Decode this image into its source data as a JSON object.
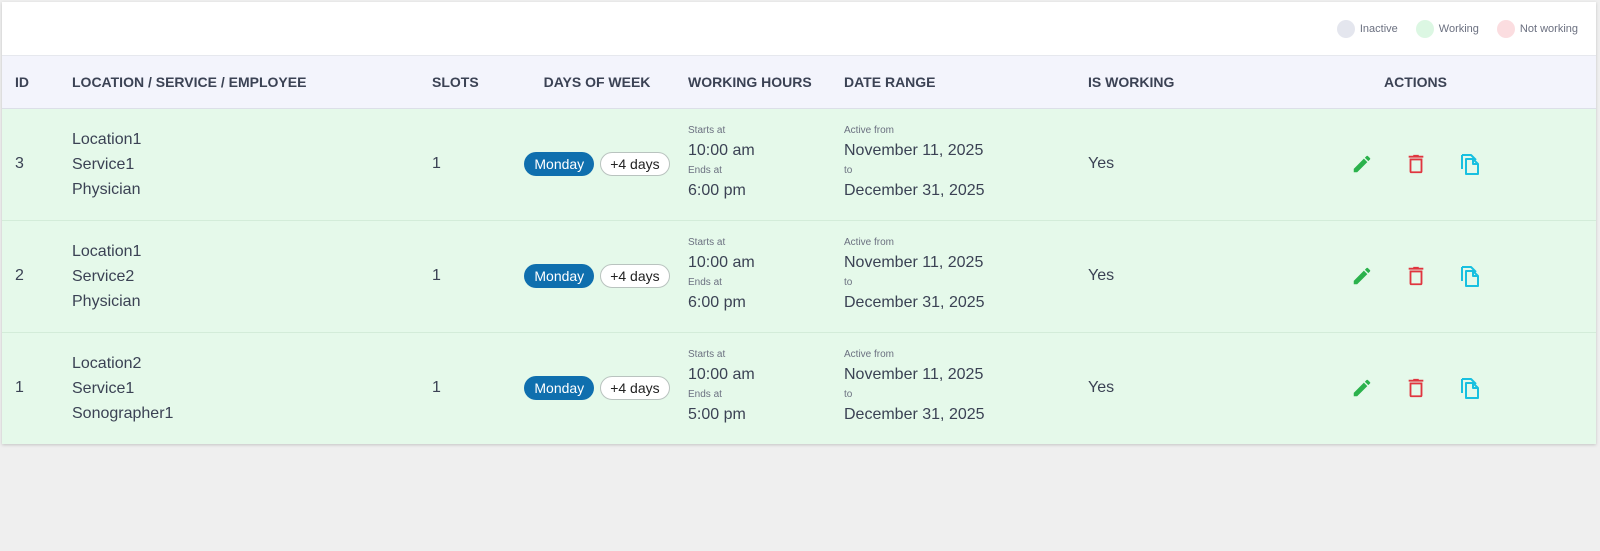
{
  "legend": [
    {
      "label": "Inactive",
      "color": "#e4e6ee"
    },
    {
      "label": "Working",
      "color": "#dcf7e3"
    },
    {
      "label": "Not working",
      "color": "#fbdde0"
    }
  ],
  "columns": {
    "id": "ID",
    "location": "LOCATION / SERVICE / EMPLOYEE",
    "slots": "SLOTS",
    "days": "DAYS OF WEEK",
    "hours": "WORKING HOURS",
    "range": "DATE RANGE",
    "working": "IS WORKING",
    "actions": "ACTIONS"
  },
  "labels": {
    "starts_at": "Starts at",
    "ends_at": "Ends at",
    "active_from": "Active from",
    "to": "to"
  },
  "rows": [
    {
      "id": "3",
      "location": "Location1",
      "service": "Service1",
      "employee": "Physician",
      "slots": "1",
      "day": "Monday",
      "more_days": "+4 days",
      "start": "10:00 am",
      "end": "6:00 pm",
      "from": "November 11, 2025",
      "to": "December 31, 2025",
      "is_working": "Yes"
    },
    {
      "id": "2",
      "location": "Location1",
      "service": "Service2",
      "employee": "Physician",
      "slots": "1",
      "day": "Monday",
      "more_days": "+4 days",
      "start": "10:00 am",
      "end": "6:00 pm",
      "from": "November 11, 2025",
      "to": "December 31, 2025",
      "is_working": "Yes"
    },
    {
      "id": "1",
      "location": "Location2",
      "service": "Service1",
      "employee": "Sonographer1",
      "slots": "1",
      "day": "Monday",
      "more_days": "+4 days",
      "start": "10:00 am",
      "end": "5:00 pm",
      "from": "November 11, 2025",
      "to": "December 31, 2025",
      "is_working": "Yes"
    }
  ],
  "icons": {
    "edit": "pencil-icon",
    "delete": "trash-icon",
    "copy": "copy-icon"
  },
  "colors": {
    "edit": "#2bb24c",
    "delete": "#e0353f",
    "copy": "#18c0e0",
    "day_badge": "#0f6fae",
    "row_working": "#e5f9ea",
    "header_bg": "#f3f4fc"
  }
}
